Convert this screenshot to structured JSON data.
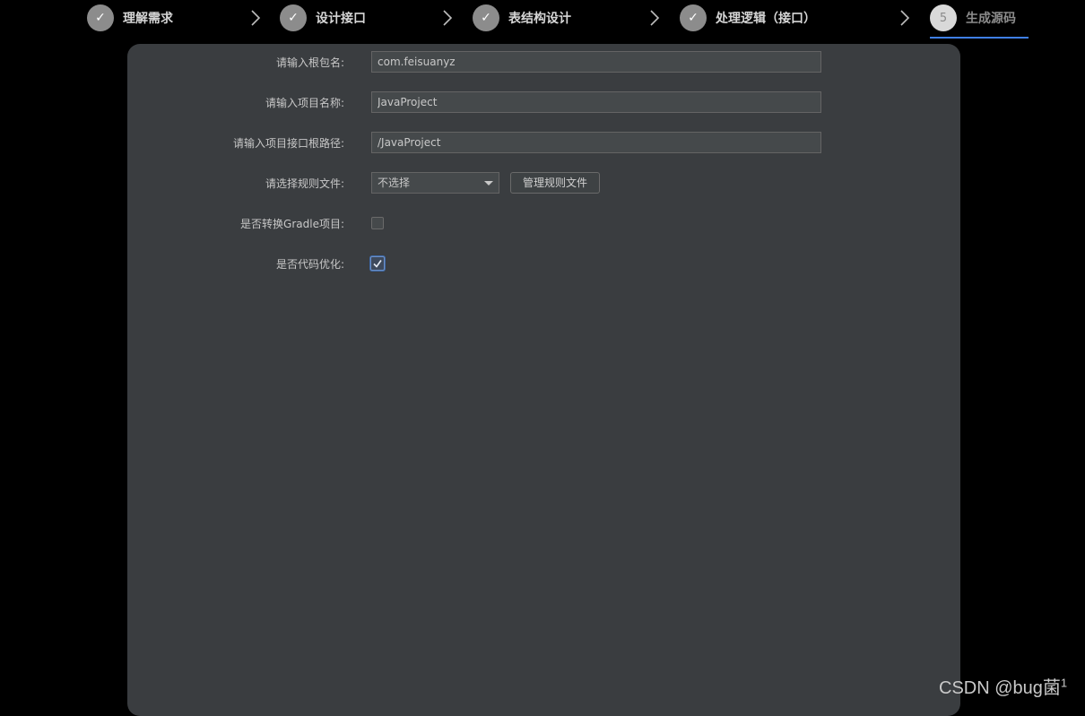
{
  "stepper": {
    "steps": [
      {
        "number": "✓",
        "label": "理解需求",
        "state": "done"
      },
      {
        "number": "✓",
        "label": "设计接口",
        "state": "done"
      },
      {
        "number": "✓",
        "label": "表结构设计",
        "state": "done"
      },
      {
        "number": "✓",
        "label": "处理逻辑（接口）",
        "state": "done"
      },
      {
        "number": "5",
        "label": "生成源码",
        "state": "current"
      }
    ],
    "active_color": "#3f7fe6"
  },
  "form": {
    "root_package": {
      "label": "请输入根包名:",
      "value": "com.feisuanyz"
    },
    "project_name": {
      "label": "请输入项目名称:",
      "value": "JavaProject"
    },
    "api_root_path": {
      "label": "请输入项目接口根路径:",
      "value": "/JavaProject"
    },
    "rule_file": {
      "label": "请选择规则文件:",
      "selected": "不选择",
      "manage_button": "管理规则文件"
    },
    "gradle_convert": {
      "label": "是否转换Gradle项目:",
      "checked": false
    },
    "code_optimize": {
      "label": "是否代码优化:",
      "checked": true
    }
  },
  "watermark": {
    "text": "CSDN @bug菌",
    "superscript": "1"
  }
}
